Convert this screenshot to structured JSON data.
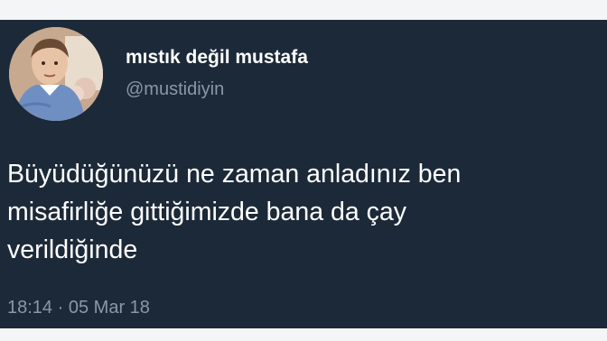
{
  "author": {
    "display_name": "mıstık değil mustafa",
    "handle": "@mustidiyin",
    "avatar_icon": "profile-photo-child"
  },
  "tweet": {
    "lines": [
      "Büyüdüğünüzü ne zaman anladınız ben",
      "misafirliğe gittiğimizde bana da çay",
      "verildiğinde"
    ],
    "time": "18:14",
    "separator": "·",
    "date": "05 Mar 18"
  },
  "colors": {
    "card_background": "#1c2938",
    "primary_text": "#ffffff",
    "secondary_text": "#8899a6"
  }
}
